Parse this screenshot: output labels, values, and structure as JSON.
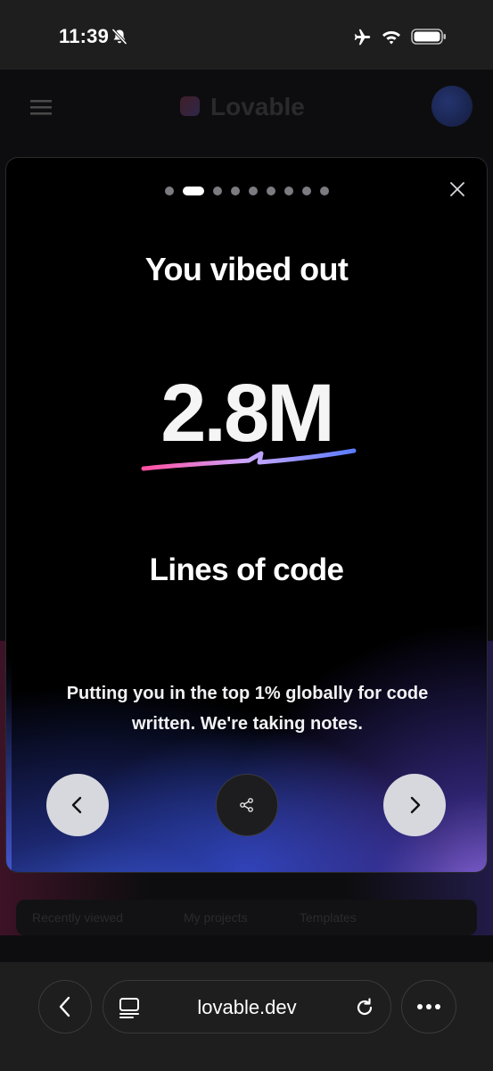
{
  "status_bar": {
    "time": "11:39",
    "icons": [
      "bell-off-icon",
      "airplane-icon",
      "wifi-icon",
      "battery-icon"
    ]
  },
  "background_page": {
    "logo_text": "Lovable",
    "tabs": [
      "Recently viewed",
      "My projects",
      "Templates"
    ]
  },
  "modal": {
    "progress": {
      "total_steps": 9,
      "current_step": 2
    },
    "title": "You vibed out",
    "stat_value": "2.8M",
    "stat_label": "Lines of code",
    "description": "Putting you in the top 1% globally for code written. We're taking notes.",
    "buttons": {
      "previous": "chevron-left-icon",
      "share": "share-icon",
      "next": "chevron-right-icon",
      "close": "close-icon"
    },
    "colors": {
      "squiggle_start": "#ff4fa0",
      "squiggle_mid": "#c9a8ff",
      "squiggle_end": "#5b7cff",
      "glow_blue": "#466eff",
      "glow_purple": "#a078ff"
    }
  },
  "browser": {
    "url": "lovable.dev",
    "icons": [
      "back-icon",
      "tabs-icon",
      "reload-icon",
      "more-icon"
    ]
  }
}
